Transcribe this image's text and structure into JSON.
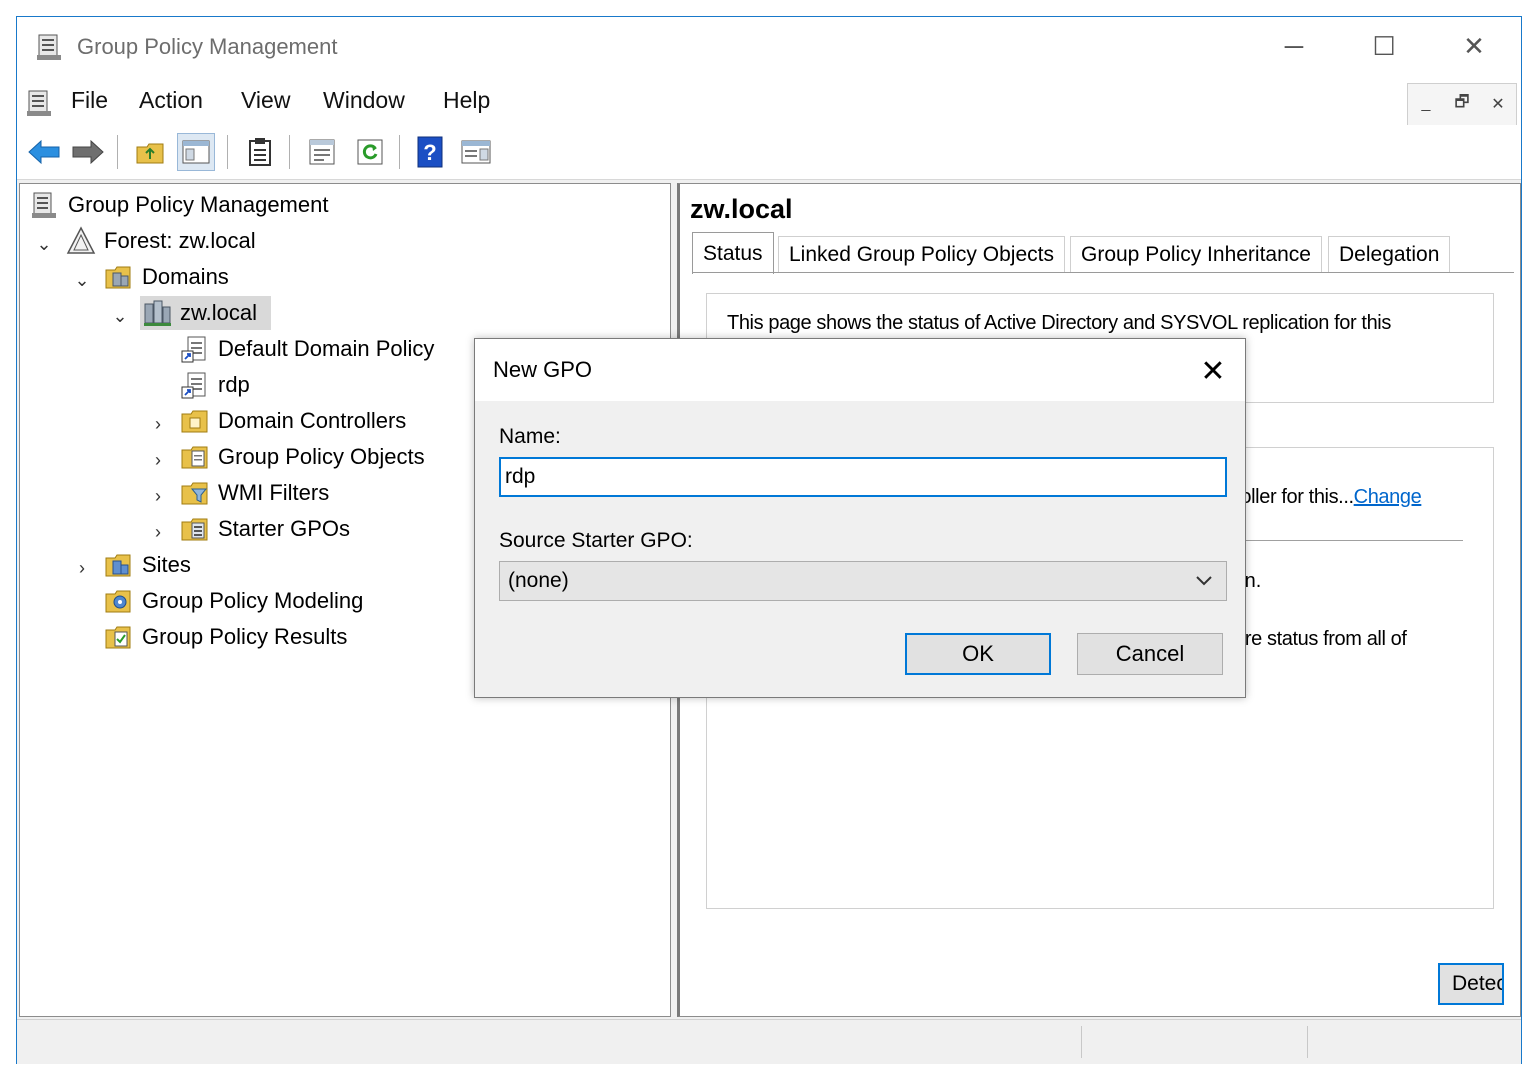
{
  "window": {
    "title": "Group Policy Management",
    "controls": {
      "minimize": "─",
      "maximize": "☐",
      "close": "✕"
    }
  },
  "menubar": {
    "items": [
      "File",
      "Action",
      "View",
      "Window",
      "Help"
    ],
    "mdi_controls": {
      "minimize": "_",
      "restore": "🗗",
      "close": "✕"
    }
  },
  "toolbar": {
    "buttons": [
      "back-icon",
      "forward-icon",
      "up-folder-icon",
      "show-hide-tree-icon",
      "clipboard-icon",
      "properties-icon",
      "refresh-icon",
      "help-icon",
      "action-pane-icon"
    ]
  },
  "tree": {
    "root": "Group Policy Management",
    "forest": "Forest: zw.local",
    "domains": "Domains",
    "domain": "zw.local",
    "default_policy": "Default Domain Policy",
    "rdp": "rdp",
    "domain_controllers": "Domain Controllers",
    "gpo_objects": "Group Policy Objects",
    "wmi_filters": "WMI Filters",
    "starter_gpos": "Starter GPOs",
    "sites": "Sites",
    "modeling": "Group Policy Modeling",
    "results": "Group Policy Results"
  },
  "right": {
    "title": "zw.local",
    "tabs": [
      "Status",
      "Linked Group Policy Objects",
      "Group Policy Inheritance",
      "Delegation"
    ],
    "status_text": "This page shows the status of Active Directory and SYSVOL replication for this",
    "controller_text": "troller for this...",
    "change_link": "Change",
    "domain_text": "ain.",
    "infrastructure_text": "ture status from all of",
    "detect_button": "Detec"
  },
  "dialog": {
    "title": "New GPO",
    "close": "✕",
    "name_label": "Name:",
    "name_value": "rdp",
    "source_label": "Source Starter GPO:",
    "source_value": "(none)",
    "ok": "OK",
    "cancel": "Cancel"
  },
  "colors": {
    "accent": "#0078d7",
    "window_border": "#1979ca",
    "selection": "#d9d9d9",
    "link": "#0066cc"
  }
}
